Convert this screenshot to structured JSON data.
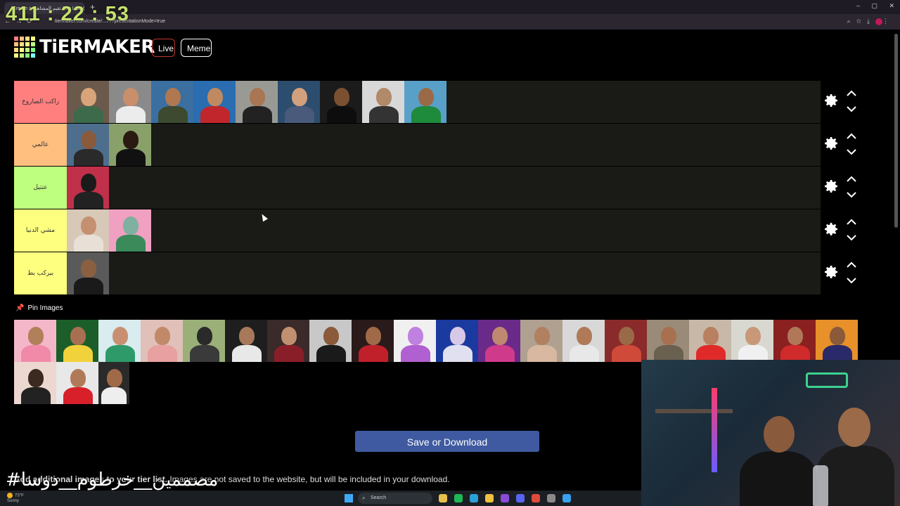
{
  "browser": {
    "tab_title": "Create a تقيم المشاهير Tier List",
    "url": "tiermaker.com/create/...77?presentationMode=true",
    "timer_overlay": "411 : 22 : 53"
  },
  "header": {
    "logo_text": "TiERMAKER",
    "live_label": "Live",
    "meme_label": "Meme"
  },
  "tiers": [
    {
      "label": "راكب الصاروخ",
      "color": "#ff7f7f",
      "items": 9
    },
    {
      "label": "عالمي",
      "color": "#ffbf7f",
      "items": 2
    },
    {
      "label": "عتتيل",
      "color": "#bfff7f",
      "items": 1
    },
    {
      "label": "مشي الدنيا",
      "color": "#ffff7f",
      "items": 2
    },
    {
      "label": "بيركب بط",
      "color": "#ffff7f",
      "items": 1
    }
  ],
  "pin_images_label": "Pin Images",
  "pool_count": 23,
  "save_button_label": "Save or Download",
  "footnote_bold": "Add additional images to your tier list.",
  "footnote_rest": " Images are not saved to the website, but will be included in your download.",
  "overlay_hashtag": "#مصممين__خرطوم__دوسا",
  "taskbar": {
    "weather_temp": "73°F",
    "weather_desc": "Sunny",
    "search_placeholder": "Search"
  }
}
